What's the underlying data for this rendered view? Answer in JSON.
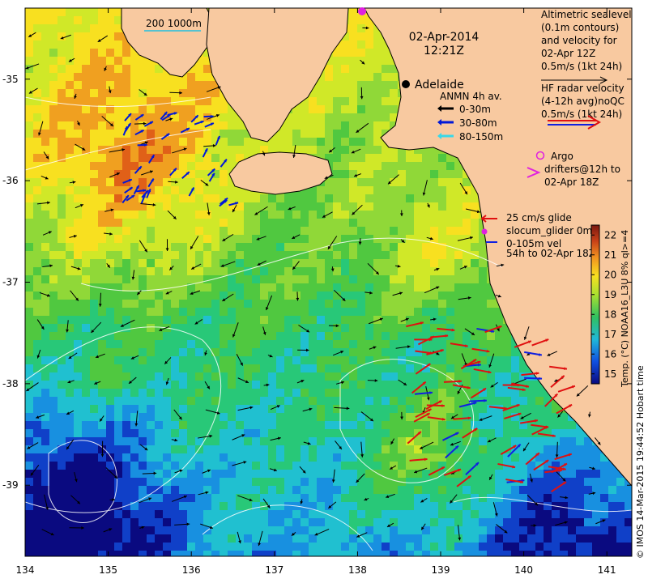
{
  "map": {
    "date": "02-Apr-2014",
    "time": "12:21Z",
    "scale_bar": "200  1000m",
    "place_label": "Adelaide",
    "x_ticks": [
      {
        "value": 134,
        "label": "134"
      },
      {
        "value": 135,
        "label": "135"
      },
      {
        "value": 136,
        "label": "136"
      },
      {
        "value": 137,
        "label": "137"
      },
      {
        "value": 138,
        "label": "138"
      },
      {
        "value": 139,
        "label": "139"
      },
      {
        "value": 140,
        "label": "140"
      },
      {
        "value": 141,
        "label": "141"
      }
    ],
    "y_ticks": [
      {
        "value": -35,
        "label": "-35"
      },
      {
        "value": -36,
        "label": "-36"
      },
      {
        "value": -37,
        "label": "-37"
      },
      {
        "value": -38,
        "label": "-38"
      },
      {
        "value": -39,
        "label": "-39"
      }
    ],
    "lon_range": [
      134,
      141.3
    ],
    "lat_range": [
      -39.7,
      -34.3
    ],
    "colors": {
      "land": "#f8c9a0",
      "ocean_base": "#55c84a",
      "anmn_shallow": "#000000",
      "anmn_mid": "#0018d8",
      "anmn_deep": "#38d8e8",
      "hf_radar": "#e01010",
      "argo": "#e020e0"
    }
  },
  "legend": {
    "altimetry": [
      "Altimetric sealevel",
      "(0.1m contours)",
      "and velocity for",
      "02-Apr 12Z",
      "0.5m/s (1kt 24h)"
    ],
    "hf_radar": [
      "HF radar velocity",
      "(4-12h avg)noQC",
      "0.5m/s (1kt 24h)"
    ],
    "anmn_title": "ANMN 4h av.",
    "anmn_items": [
      "0-30m",
      "30-80m",
      "80-150m"
    ],
    "argo": [
      "Argo",
      "drifters@12h to",
      "02-Apr 18Z"
    ],
    "glider": [
      "25 cm/s glide",
      "slocum_glider 0m",
      "0-105m vel",
      "54h to 02-Apr 18Z"
    ]
  },
  "colorbar": {
    "label": "Temp. (°C) NOAA16_L3U 8% ql>=4",
    "ticks": [
      "15",
      "16",
      "17",
      "18",
      "19",
      "20",
      "21",
      "22"
    ],
    "min": 14.5,
    "max": 22.5
  },
  "credit": "© IMOS 14-Mar-2015 19:44:52 Hobart time"
}
